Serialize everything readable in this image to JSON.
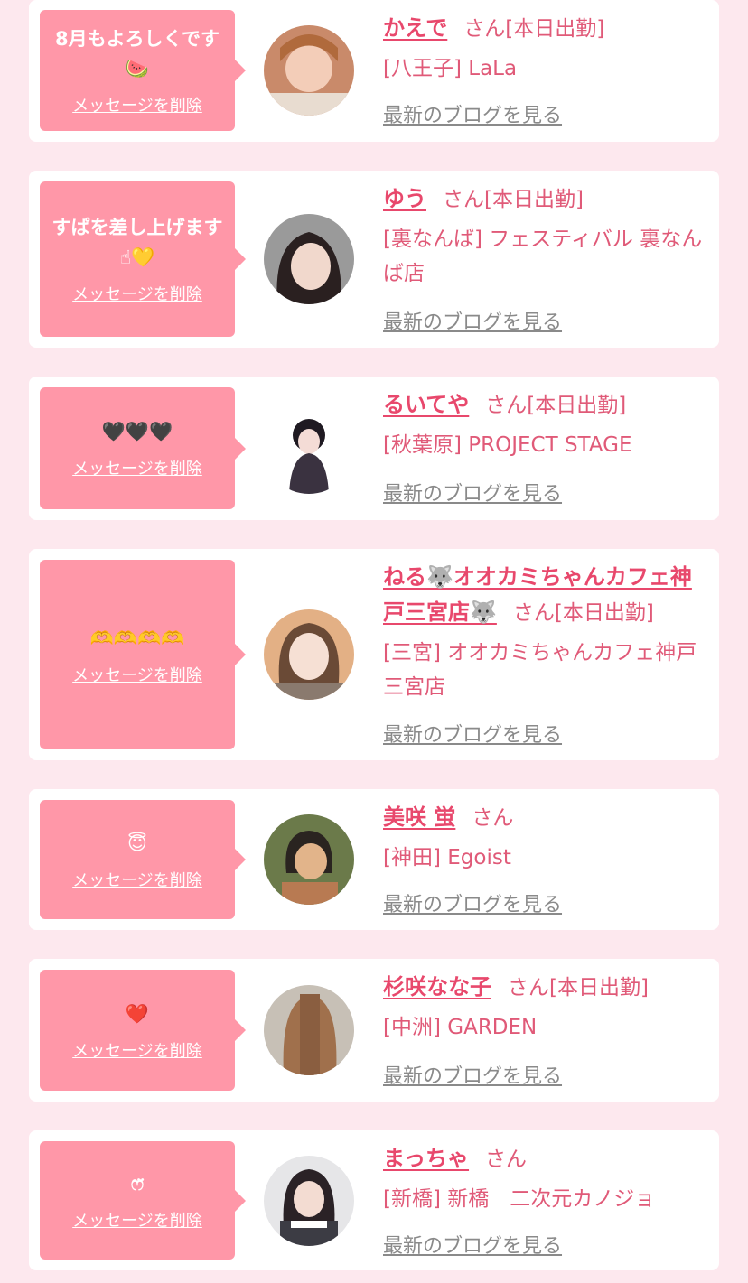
{
  "colors": {
    "page_bg": "#fde8ee",
    "bubble": "#ff97a8",
    "name": "#e8486c",
    "shop": "#e05a78",
    "blog_link": "#8a8a8a"
  },
  "delete_label": "メッセージを削除",
  "san_label": "さん",
  "blog_label": "最新のブログを見る",
  "entries": [
    {
      "message": "8月もよろしくです🍉",
      "name": "かえで",
      "status": "[本日出勤]",
      "shop": "[八王子] LaLa"
    },
    {
      "message": "すぱを差し上げます☝💛",
      "name": "ゆう",
      "status": "[本日出勤]",
      "shop": "[裏なんば] フェスティバル 裏なんば店"
    },
    {
      "message": "🖤🖤🖤",
      "name": "るいてや",
      "status": "[本日出勤]",
      "shop": "[秋葉原] PROJECT STAGE"
    },
    {
      "message": "🫶🫶🫶🫶",
      "name": "ねる🐺オオカミちゃんカフェ神戸三宮店🐺",
      "status": "[本日出勤]",
      "shop": "[三宮] オオカミちゃんカフェ神戸三宮店"
    },
    {
      "message": "😇",
      "name": "美咲 蛍",
      "status": "",
      "shop": "[神田] Egoist"
    },
    {
      "message": "❤️",
      "name": "杉咲なな子",
      "status": "[本日出勤]",
      "shop": "[中洲] GARDEN"
    },
    {
      "message": "ෆ̈",
      "name": "まっちゃ",
      "status": "",
      "shop": "[新橋] 新橋　二次元カノジョ"
    }
  ]
}
